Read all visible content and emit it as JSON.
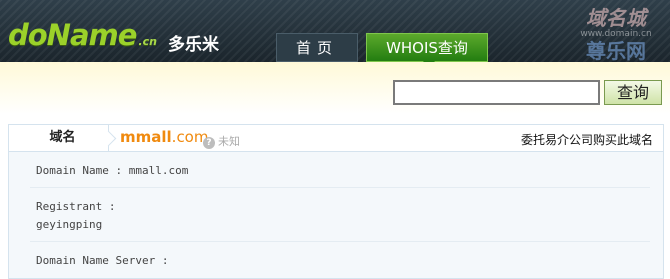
{
  "header": {
    "logo": "doName",
    "logo_tld": ".cn",
    "brand": "多乐米",
    "tabs": [
      {
        "label": "首页",
        "active": false
      },
      {
        "label": "WHOIS查询",
        "active": true
      }
    ],
    "watermark": {
      "line1": "域名城",
      "line2": "www.domain.cn",
      "line3": "尊乐网"
    }
  },
  "search": {
    "value": "",
    "button_label": "查询"
  },
  "result": {
    "field_label": "域名",
    "domain_name": "mmall",
    "domain_tld": ".com",
    "status": "未知",
    "delegate_link": "委托易介公司购买此域名",
    "records": [
      "Domain Name : mmall.com",
      "Registrant :",
      "geyingping",
      "Domain Name Server :"
    ]
  },
  "colors": {
    "accent_green": "#237d11",
    "domain_orange": "#f08a0f",
    "header_dark": "#1b252c"
  }
}
